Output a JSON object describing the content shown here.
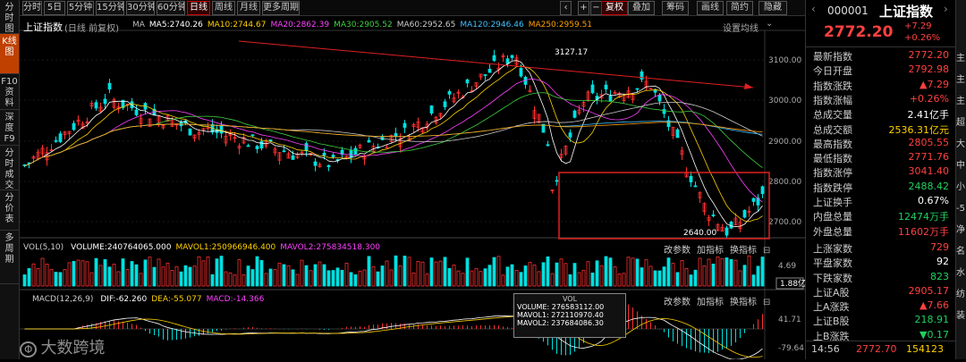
{
  "toolbar": {
    "periods": [
      "分时",
      "5日",
      "5分钟",
      "15分钟",
      "30分钟",
      "60分钟",
      "日线",
      "周线",
      "月线",
      "更多周期"
    ],
    "active_period": "日线",
    "right_buttons": [
      "复权",
      "叠加",
      "筹码",
      "画线",
      "简约",
      "隐藏"
    ]
  },
  "side_tabs": [
    "分时图",
    "K线图",
    "F10资料",
    "深度F9",
    "分时成交",
    "分价表",
    "多周期"
  ],
  "active_side_tab": "K线图",
  "main": {
    "title": "上证指数",
    "subtitle": "(日线 前复权)",
    "ma_labels": [
      {
        "text": "MA",
        "color": "#bbbbbb"
      },
      {
        "text": "MA5:2740.26",
        "color": "#ffffff"
      },
      {
        "text": "MA10:2744.67",
        "color": "#ffd000"
      },
      {
        "text": "MA20:2862.39",
        "color": "#ff40ff"
      },
      {
        "text": "MA30:2905.52",
        "color": "#40d040"
      },
      {
        "text": "MA60:2952.65",
        "color": "#cccccc"
      },
      {
        "text": "MA120:2946.46",
        "color": "#40c0ff"
      },
      {
        "text": "MA250:2959.51",
        "color": "#ffa000"
      }
    ],
    "settings_label": "设置均线",
    "y_ticks": [
      "3100.00",
      "3000.00",
      "2900.00",
      "2800.00",
      "2700.00"
    ],
    "high_label": "3127.17",
    "low_label": "2640.00"
  },
  "vol": {
    "title": "VOL(5,10)",
    "labels": [
      {
        "text": "VOLUME:240764065.000",
        "color": "#ffffff"
      },
      {
        "text": "MAVOL1:250966946.400",
        "color": "#ffd000"
      },
      {
        "text": "MAVOL2:275834518.300",
        "color": "#ff40ff"
      }
    ],
    "buttons": [
      "改参数",
      "加指标",
      "换指标"
    ],
    "y_ticks": [
      "4.69",
      "1.88亿"
    ]
  },
  "macd": {
    "title": "MACD(12,26,9)",
    "labels": [
      {
        "text": "DIF:-62.260",
        "color": "#ffffff"
      },
      {
        "text": "DEA:-55.077",
        "color": "#ffd000"
      },
      {
        "text": "MACD:-14.366",
        "color": "#ff40ff"
      }
    ],
    "buttons": [
      "改参数",
      "加指标",
      "换指标"
    ],
    "y_ticks": [
      "41.71",
      "-79.64"
    ]
  },
  "tooltip": {
    "title": "VOL",
    "lines": [
      "VOLUME: 276583112.00",
      "MAVOL1: 272110970.40",
      "MAVOL2: 237684086.30"
    ]
  },
  "watermark": "大数跨境",
  "quote": {
    "code": "000001",
    "name": "上证指数",
    "price": "2772.20",
    "change": "+7.29",
    "change_pct": "+0.26%",
    "rows": [
      {
        "label": "最新指数",
        "value": "2772.20",
        "color": "red"
      },
      {
        "label": "今日开盘",
        "value": "2792.98",
        "color": "red"
      },
      {
        "label": "指数涨跌",
        "value": "▲7.29",
        "color": "red"
      },
      {
        "label": "指数涨幅",
        "value": "+0.26%",
        "color": "red"
      },
      {
        "label": "总成交量",
        "value": "2.41亿手",
        "color": "wht"
      },
      {
        "label": "总成交额",
        "value": "2536.31亿元",
        "color": "yel"
      },
      {
        "label": "最高指数",
        "value": "2805.55",
        "color": "red"
      },
      {
        "label": "最低指数",
        "value": "2771.76",
        "color": "red"
      },
      {
        "label": "指数涨停",
        "value": "3041.40",
        "color": "red"
      },
      {
        "label": "指数跌停",
        "value": "2488.42",
        "color": "grn"
      },
      {
        "label": "上证换手",
        "value": "0.67%",
        "color": "wht"
      },
      {
        "label": "内盘总量",
        "value": "12474万手",
        "color": "grn"
      },
      {
        "label": "外盘总量",
        "value": "11602万手",
        "color": "red"
      },
      {
        "label": "上涨家数",
        "value": "729",
        "color": "red"
      },
      {
        "label": "平盘家数",
        "value": "92",
        "color": "wht"
      },
      {
        "label": "下跌家数",
        "value": "823",
        "color": "grn"
      },
      {
        "label": "上证A股",
        "value": "2905.17",
        "color": "red"
      },
      {
        "label": "上A涨跌",
        "value": "▲7.66",
        "color": "red"
      },
      {
        "label": "上证B股",
        "value": "218.91",
        "color": "grn"
      },
      {
        "label": "上B涨跌",
        "value": "▼0.17",
        "color": "grn"
      }
    ],
    "tick": {
      "time": "14:56",
      "price": "2772.70",
      "volume": "154123"
    }
  },
  "edge_texts": [
    "主",
    "主",
    "主",
    "超",
    "大",
    "中",
    "小",
    "-5",
    "净",
    "名",
    "水",
    "纺",
    "装"
  ]
}
